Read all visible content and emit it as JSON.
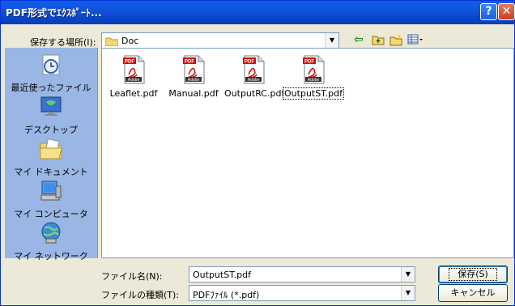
{
  "title": "PDF形式でｴｸｽﾎﾟｰﾄ...",
  "title_buttons": {
    "help": "?",
    "close": "✕"
  },
  "save_location": {
    "label": "保存する場所(I):",
    "value": "Doc"
  },
  "places": [
    {
      "label": "最近使ったファイル",
      "icon": "recent-icon"
    },
    {
      "label": "デスクトップ",
      "icon": "desktop-icon"
    },
    {
      "label": "マイ ドキュメント",
      "icon": "my-documents-icon"
    },
    {
      "label": "マイ コンピュータ",
      "icon": "my-computer-icon"
    },
    {
      "label": "マイ ネットワーク",
      "icon": "my-network-icon"
    }
  ],
  "files": [
    {
      "name": "Leaflet.pdf",
      "selected": false,
      "badge": "PDF",
      "brand": "Adobe"
    },
    {
      "name": "Manual.pdf",
      "selected": false,
      "badge": "PDF",
      "brand": "Adobe"
    },
    {
      "name": "OutputRC.pdf",
      "selected": false,
      "badge": "PDF",
      "brand": "Adobe"
    },
    {
      "name": "OutputST.pdf",
      "selected": true,
      "badge": "PDF",
      "brand": "Adobe"
    }
  ],
  "filename": {
    "label": "ファイル名(N):",
    "value": "OutputST.pdf"
  },
  "filetype": {
    "label": "ファイルの種類(T):",
    "value": "PDFﾌｧｲﾙ (*.pdf)"
  },
  "buttons": {
    "save": "保存(S)",
    "cancel": "キャンセル"
  }
}
